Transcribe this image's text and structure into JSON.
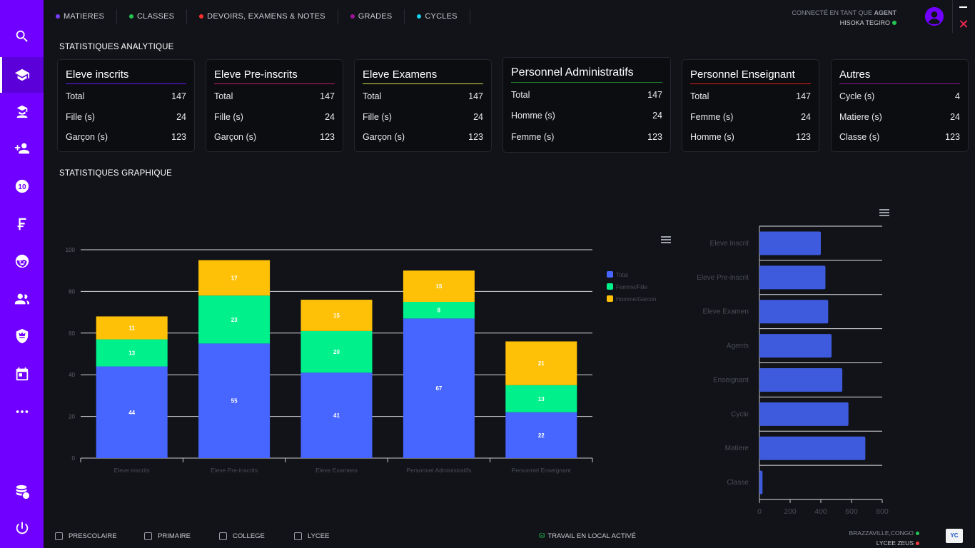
{
  "nav": {
    "items": [
      {
        "label": "MATIERES",
        "color": "#7b3cff"
      },
      {
        "label": "CLASSES",
        "color": "#23c552"
      },
      {
        "label": "DEVOIRS, EXAMENS & NOTES",
        "color": "#ff3030"
      },
      {
        "label": "GRADES",
        "color": "#a0149a"
      },
      {
        "label": "CYCLES",
        "color": "#19d3f0"
      }
    ]
  },
  "user": {
    "connected_prefix": "CONNECTÉ EN TANT QUE",
    "role": "AGENT",
    "name": "HISOKA TEGIRO"
  },
  "sidebar": {
    "items": [
      {
        "name": "search-icon"
      },
      {
        "name": "school-icon",
        "active": true
      },
      {
        "name": "student-icon"
      },
      {
        "name": "add-user-icon"
      },
      {
        "name": "grade-ten-icon"
      },
      {
        "name": "currency-icon"
      },
      {
        "name": "child-face-icon"
      },
      {
        "name": "group-icon"
      },
      {
        "name": "shield-crown-icon"
      },
      {
        "name": "calendar-icon"
      },
      {
        "name": "more-dots-icon"
      },
      {
        "name": "database-sync-icon"
      },
      {
        "name": "power-icon"
      }
    ]
  },
  "analytics": {
    "title": "STATISTIQUES ANALYTIQUE",
    "cards": [
      {
        "title": "Eleve inscrits",
        "underline": "#6a1bff",
        "rows": [
          [
            "Total",
            "147"
          ],
          [
            "Fille (s)",
            "24"
          ],
          [
            "Garçon (s)",
            "123"
          ]
        ]
      },
      {
        "title": "Eleve Pre-inscrits",
        "underline": "#c21a6a",
        "rows": [
          [
            "Total",
            "147"
          ],
          [
            "Fille (s)",
            "24"
          ],
          [
            "Garçon (s)",
            "123"
          ]
        ]
      },
      {
        "title": "Eleve Examens",
        "underline": "#d6e04a",
        "rows": [
          [
            "Total",
            "147"
          ],
          [
            "Fille (s)",
            "24"
          ],
          [
            "Garçon (s)",
            "123"
          ]
        ]
      },
      {
        "title": "Personnel Administratifs",
        "underline": "#1e7a2c",
        "rows": [
          [
            "Total",
            "147"
          ],
          [
            "Homme (s)",
            "24"
          ],
          [
            "Femme (s)",
            "123"
          ]
        ]
      },
      {
        "title": "Personnel Enseignant",
        "underline": "#e02020",
        "rows": [
          [
            "Total",
            "147"
          ],
          [
            "Femme (s)",
            "24"
          ],
          [
            "Homme (s)",
            "123"
          ]
        ]
      },
      {
        "title": "Autres",
        "underline": "#8a1a9a",
        "rows": [
          [
            "Cycle (s)",
            "4"
          ],
          [
            "Matiere (s)",
            "24"
          ],
          [
            "Classe (s)",
            "123"
          ]
        ]
      }
    ]
  },
  "graphics": {
    "title": "STATISTIQUES GRAPHIQUE"
  },
  "chart_data": [
    {
      "type": "bar",
      "stacked": true,
      "categories": [
        "Eleve inscrits",
        "Eleve Pre-inscrits",
        "Eleve Examens",
        "Personnel Administratifs",
        "Personnel Enseignant"
      ],
      "series": [
        {
          "name": "Total",
          "color": "#4765ff",
          "values": [
            44,
            55,
            41,
            67,
            22
          ]
        },
        {
          "name": "Femme/Fille",
          "color": "#00f08c",
          "values": [
            13,
            23,
            20,
            8,
            13
          ]
        },
        {
          "name": "Homme/Garcon",
          "color": "#ffc107",
          "values": [
            11,
            17,
            15,
            15,
            21
          ]
        }
      ],
      "yticks": [
        "0",
        "20",
        "40",
        "60",
        "80",
        "100"
      ],
      "ylim": [
        0,
        100
      ],
      "grid": true,
      "legend": "right"
    },
    {
      "type": "bar",
      "orientation": "horizontal",
      "categories": [
        "Eleve Inscrit",
        "Eleve Pre-inscrit",
        "Eleve Examen",
        "Agents",
        "Enseignant",
        "Cycle",
        "Matiere",
        "Classe"
      ],
      "values": [
        400,
        430,
        448,
        470,
        540,
        580,
        690,
        20
      ],
      "color": "#3d5bdc",
      "xticks": [
        "0",
        "200",
        "400",
        "600",
        "800"
      ],
      "xlim": [
        0,
        800
      ]
    }
  ],
  "filters": [
    {
      "label": "PRESCOLAIRE"
    },
    {
      "label": "PRIMAIRE"
    },
    {
      "label": "COLLEGE"
    },
    {
      "label": "LYCEE"
    }
  ],
  "status": {
    "local_label": "TRAVAIL EN LOCAL ACTIVÉ",
    "location": "BRAZZAVILLE,CONGO",
    "school": "LYCEE ZEUS"
  },
  "logo": {
    "text": "YC"
  }
}
